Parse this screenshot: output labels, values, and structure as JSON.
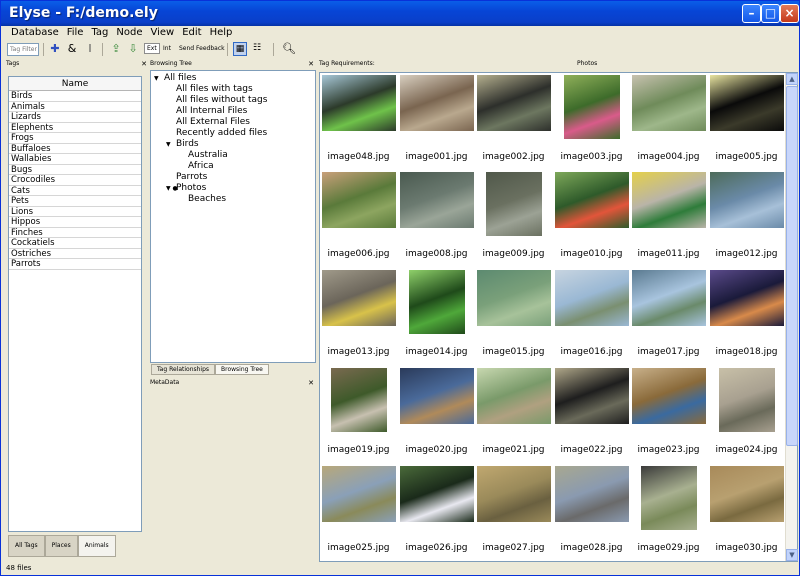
{
  "window": {
    "title": "Elyse - F:/demo.ely"
  },
  "menu": [
    "Database",
    "File",
    "Tag",
    "Node",
    "View",
    "Edit",
    "Help"
  ],
  "toolbar": {
    "tag_filter_placeholder": "Tag Filter",
    "ext_label": "Ext",
    "int_label": "Int",
    "send_feedback_label": "Send Feedback"
  },
  "tags_panel": {
    "title": "Tags",
    "column_header": "Name",
    "items": [
      "Birds",
      "Animals",
      "Lizards",
      "Elephents",
      "Frogs",
      "Buffaloes",
      "Wallabies",
      "Bugs",
      "Crocodiles",
      "Cats",
      "Pets",
      "Lions",
      "Hippos",
      "Finches",
      "Cockatiels",
      "Ostriches",
      "Parrots"
    ],
    "tabs": [
      "All Tags",
      "Places",
      "Animals"
    ],
    "selected_tab": "Animals"
  },
  "browsing_tree": {
    "title": "Browsing Tree",
    "rows": [
      {
        "label": "All files",
        "level": 0,
        "expander": "▼"
      },
      {
        "label": "All files with tags",
        "level": 1,
        "expander": ""
      },
      {
        "label": "All files without tags",
        "level": 1,
        "expander": ""
      },
      {
        "label": "All Internal Files",
        "level": 1,
        "expander": ""
      },
      {
        "label": "All External Files",
        "level": 1,
        "expander": ""
      },
      {
        "label": "Recently added files",
        "level": 1,
        "expander": ""
      },
      {
        "label": "Birds",
        "level": 1,
        "expander": "▼"
      },
      {
        "label": "Australia",
        "level": 2,
        "expander": ""
      },
      {
        "label": "Africa",
        "level": 2,
        "expander": ""
      },
      {
        "label": "Parrots",
        "level": 1,
        "expander": ""
      },
      {
        "label": "Photos",
        "level": 1,
        "expander": "▼ ●"
      },
      {
        "label": "Beaches",
        "level": 2,
        "expander": ""
      }
    ],
    "selected": "Photos",
    "tabs": [
      "Tag Relationships",
      "Browsing Tree"
    ],
    "selected_tab": "Browsing Tree"
  },
  "metadata_panel": {
    "title": "MetaData"
  },
  "photos_panel": {
    "tag_requirements_label": "Tag Requirements:",
    "title": "Photos",
    "images": [
      {
        "name": "image048.jpg",
        "colors": [
          "#2c3a2a",
          "#6fc24a",
          "#a8c8d8"
        ]
      },
      {
        "name": "image001.jpg",
        "colors": [
          "#7a6550",
          "#b9a88e",
          "#d8cfc0"
        ]
      },
      {
        "name": "image002.jpg",
        "colors": [
          "#2d2f2b",
          "#6d7760",
          "#b5b08f"
        ]
      },
      {
        "name": "image003.jpg",
        "colors": [
          "#3d6b2a",
          "#d95b8a",
          "#90b05a"
        ]
      },
      {
        "name": "image004.jpg",
        "colors": [
          "#6f8b5a",
          "#9eb78a",
          "#c8c2b0"
        ]
      },
      {
        "name": "image005.jpg",
        "colors": [
          "#0a0a0a",
          "#3b3a2a",
          "#e8e4a0"
        ]
      },
      {
        "name": "image006.jpg",
        "colors": [
          "#5a7a3a",
          "#8da560",
          "#c9a07a"
        ]
      },
      {
        "name": "image008.jpg",
        "colors": [
          "#6b7a70",
          "#9aa598",
          "#4a5a50"
        ]
      },
      {
        "name": "image009.jpg",
        "colors": [
          "#6a7060",
          "#9ca295",
          "#50584a"
        ]
      },
      {
        "name": "image010.jpg",
        "colors": [
          "#2e5a2a",
          "#e2553a",
          "#7ea85a"
        ]
      },
      {
        "name": "image011.jpg",
        "colors": [
          "#b9b4a8",
          "#2e7c3a",
          "#e4d04a"
        ]
      },
      {
        "name": "image012.jpg",
        "colors": [
          "#6a8aa8",
          "#a7c0d8",
          "#4d6b5a"
        ]
      },
      {
        "name": "image013.jpg",
        "colors": [
          "#6b655a",
          "#d8c24a",
          "#a09a8a"
        ]
      },
      {
        "name": "image014.jpg",
        "colors": [
          "#1f4a1a",
          "#4fa83a",
          "#8fd06a"
        ]
      },
      {
        "name": "image015.jpg",
        "colors": [
          "#7aa07a",
          "#a7c29a",
          "#5c8a70"
        ]
      },
      {
        "name": "image016.jpg",
        "colors": [
          "#9ab8d4",
          "#7a8f70",
          "#c7d4e0"
        ]
      },
      {
        "name": "image017.jpg",
        "colors": [
          "#a8c4de",
          "#6a8a6a",
          "#5a7a90"
        ]
      },
      {
        "name": "image018.jpg",
        "colors": [
          "#1a1a3a",
          "#d88a4a",
          "#5a4a8a"
        ]
      },
      {
        "name": "image019.jpg",
        "colors": [
          "#3e5a2a",
          "#c7c0b0",
          "#7a6a50"
        ]
      },
      {
        "name": "image020.jpg",
        "colors": [
          "#4a6a9a",
          "#b08a5a",
          "#2a3a5a"
        ]
      },
      {
        "name": "image021.jpg",
        "colors": [
          "#7a9a6a",
          "#b0a080",
          "#c8d8b0"
        ]
      },
      {
        "name": "image022.jpg",
        "colors": [
          "#1e1e1e",
          "#6a6a5a",
          "#b0a88a"
        ]
      },
      {
        "name": "image023.jpg",
        "colors": [
          "#8a6a3a",
          "#3a6aa0",
          "#c8b08a"
        ]
      },
      {
        "name": "image024.jpg",
        "colors": [
          "#a8a090",
          "#6a6a5a",
          "#c8c0a8"
        ]
      },
      {
        "name": "image025.jpg",
        "colors": [
          "#8aa0b8",
          "#8a8a5a",
          "#b8a87a"
        ]
      },
      {
        "name": "image026.jpg",
        "colors": [
          "#1a2a1a",
          "#e8e8f0",
          "#4a6a3a"
        ]
      },
      {
        "name": "image027.jpg",
        "colors": [
          "#9a8a5a",
          "#6a6040",
          "#c0a870"
        ]
      },
      {
        "name": "image028.jpg",
        "colors": [
          "#8a9ab0",
          "#6a6a6a",
          "#a8a890"
        ]
      },
      {
        "name": "image029.jpg",
        "colors": [
          "#a8b090",
          "#7a8a5a",
          "#3a3a3a"
        ]
      },
      {
        "name": "image030.jpg",
        "colors": [
          "#b8a070",
          "#7a6a40",
          "#a88a5a"
        ]
      }
    ]
  },
  "status": {
    "text": "48 files"
  }
}
